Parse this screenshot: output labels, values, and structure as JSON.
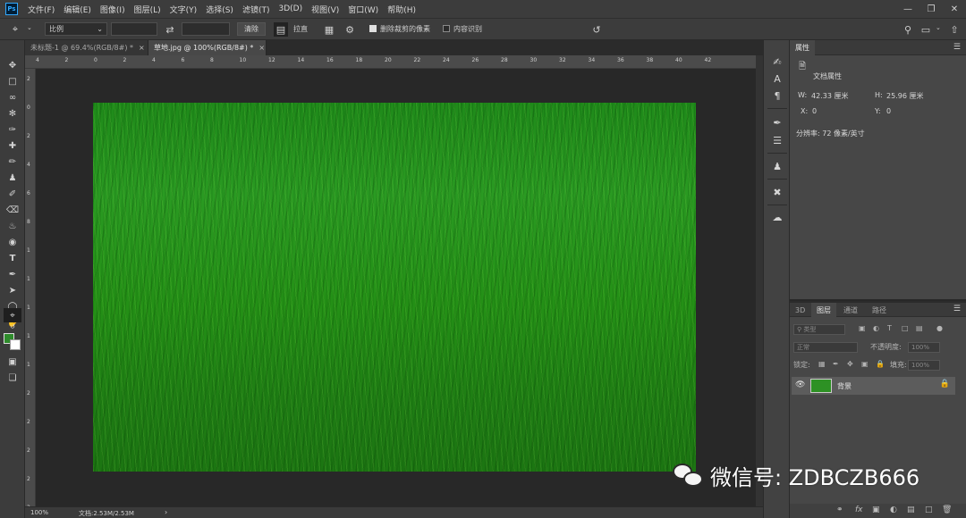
{
  "app": {
    "logo_text": "Ps",
    "menu": [
      "文件(F)",
      "编辑(E)",
      "图像(I)",
      "图层(L)",
      "文字(Y)",
      "选择(S)",
      "滤镜(T)",
      "3D(D)",
      "视图(V)",
      "窗口(W)",
      "帮助(H)"
    ]
  },
  "options_bar": {
    "ratio_label": "比例",
    "clear_label": "清除",
    "straighten_label": "拉直",
    "delete_cropped_label": "删除裁剪的像素",
    "delete_cropped_checked": true,
    "content_aware_label": "内容识别",
    "content_aware_checked": false
  },
  "tabs": [
    {
      "label": "未标题-1 @ 69.4%(RGB/8#) *",
      "active": false
    },
    {
      "label": "草地.jpg @ 100%(RGB/8#) *",
      "active": true
    }
  ],
  "ruler_h": [
    "4",
    "2",
    "0",
    "2",
    "4",
    "6",
    "8",
    "10",
    "12",
    "14",
    "16",
    "18",
    "20",
    "22",
    "24",
    "26",
    "28",
    "30",
    "32",
    "34",
    "36",
    "38",
    "40",
    "42"
  ],
  "ruler_v": [
    "2",
    "0",
    "2",
    "4",
    "6",
    "8",
    "1",
    "1",
    "1",
    "1",
    "1",
    "2",
    "2",
    "2",
    "2",
    "2"
  ],
  "status": {
    "zoom": "100%",
    "doc": "文档:2.53M/2.53M"
  },
  "properties": {
    "tab": "属性",
    "section": "文档属性",
    "w_label": "W:",
    "w_value": "42.33 厘米",
    "h_label": "H:",
    "h_value": "25.96 厘米",
    "x_label": "X:",
    "x_value": "0",
    "y_label": "Y:",
    "y_value": "0",
    "resolution": "分辨率: 72 像素/英寸"
  },
  "layers": {
    "tabs": [
      "3D",
      "图层",
      "通道",
      "路径"
    ],
    "active_tab": 1,
    "filter_placeholder": "类型",
    "blend_mode": "正常",
    "opacity_label": "不透明度:",
    "opacity_value": "100%",
    "lock_label": "锁定:",
    "fill_label": "填充:",
    "fill_value": "100%",
    "layer_name": "背景"
  },
  "watermark": {
    "text": "微信号: ZDBCZB666"
  },
  "colors": {
    "foreground": "#2e8b2b",
    "background": "#ffffff",
    "ps_blue": "#31a8ff"
  }
}
